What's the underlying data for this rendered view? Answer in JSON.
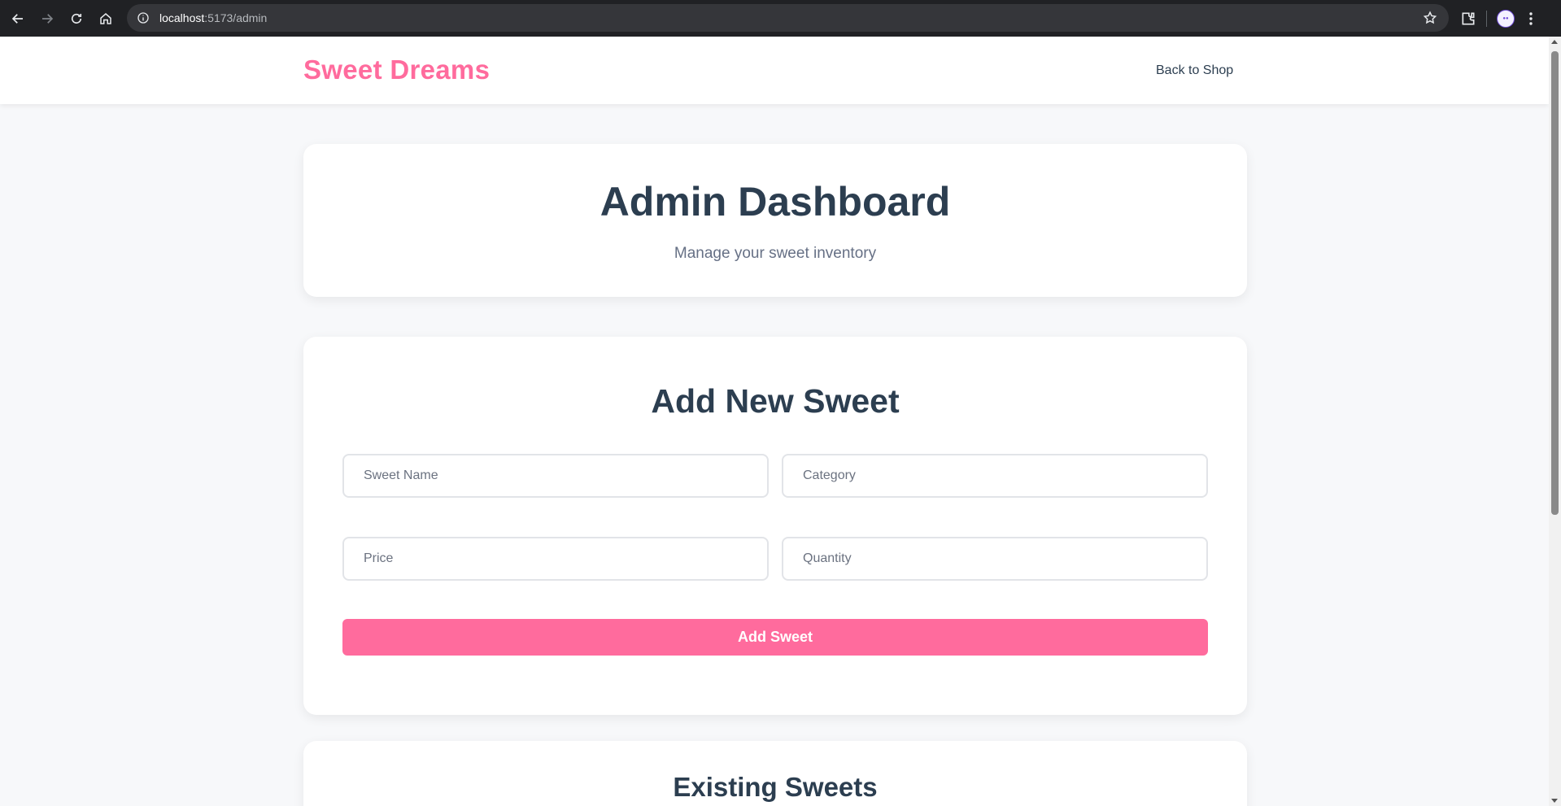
{
  "browser": {
    "url_host": "localhost",
    "url_path": ":5173/admin"
  },
  "header": {
    "brand": "Sweet Dreams",
    "back_link": "Back to Shop"
  },
  "hero": {
    "title": "Admin Dashboard",
    "subtitle": "Manage your sweet inventory"
  },
  "form": {
    "title": "Add New Sweet",
    "name_placeholder": "Sweet Name",
    "category_placeholder": "Category",
    "price_placeholder": "Price",
    "quantity_placeholder": "Quantity",
    "submit_label": "Add Sweet"
  },
  "list": {
    "title": "Existing Sweets"
  },
  "colors": {
    "brand": "#ff6b9d",
    "heading": "#2c3e50",
    "background": "#f7f8fa"
  }
}
